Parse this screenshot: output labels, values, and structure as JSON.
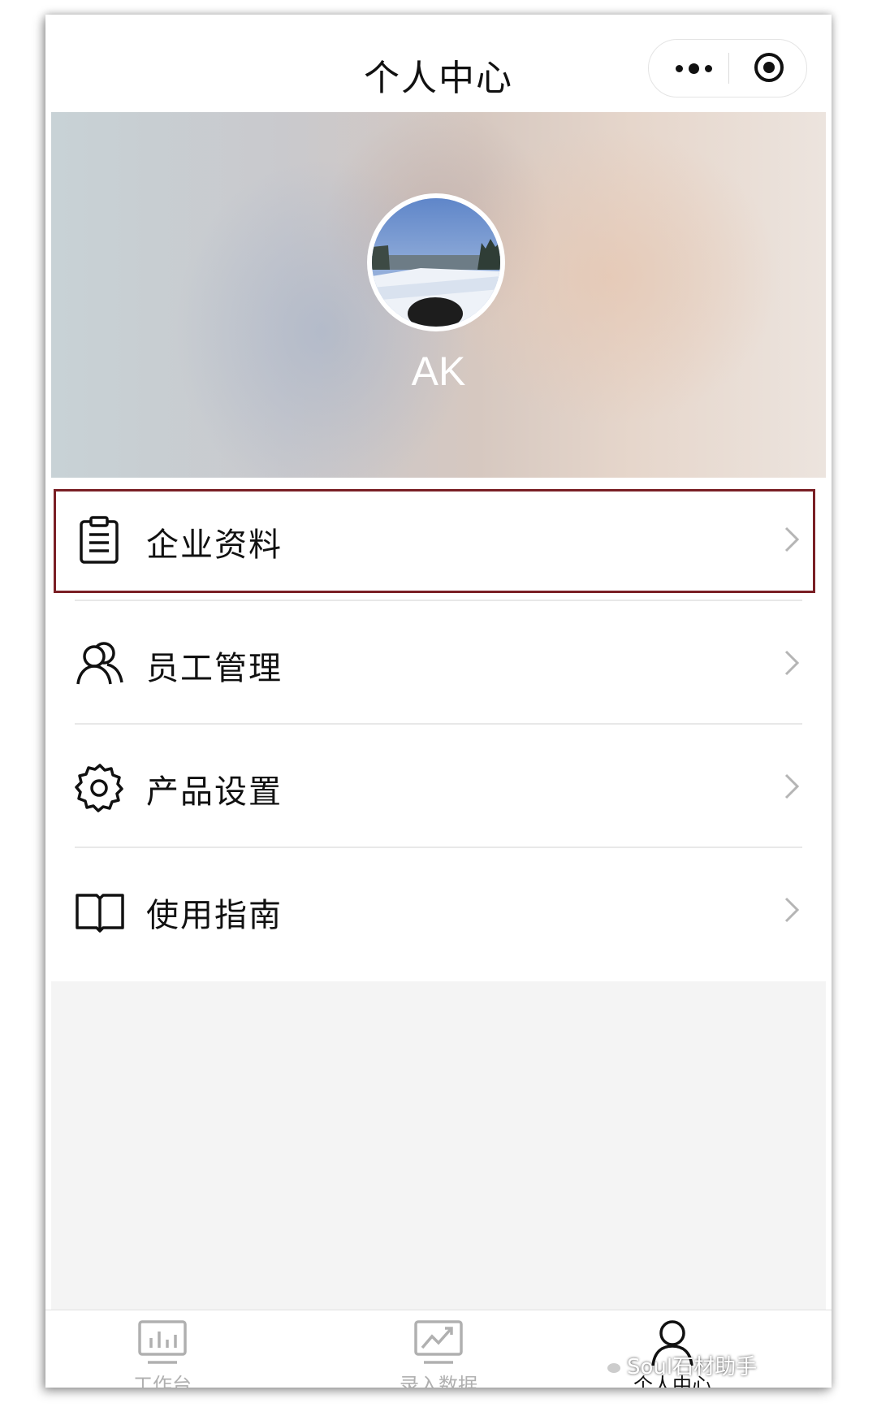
{
  "header": {
    "title": "个人中心"
  },
  "profile": {
    "name": "AK"
  },
  "menu": {
    "items": [
      {
        "label": "企业资料",
        "icon": "clipboard-icon"
      },
      {
        "label": "员工管理",
        "icon": "users-icon"
      },
      {
        "label": "产品设置",
        "icon": "gear-icon"
      },
      {
        "label": "使用指南",
        "icon": "book-icon"
      }
    ]
  },
  "tabbar": {
    "items": [
      {
        "label": "工作台",
        "icon": "bar-chart-icon"
      },
      {
        "label": "录入数据",
        "icon": "trend-chart-icon"
      },
      {
        "label": "个人中心",
        "icon": "user-icon"
      }
    ],
    "active_index": 2
  },
  "watermark": {
    "text": "Soul石材助手"
  },
  "colors": {
    "highlight_border": "#7a1f25",
    "inactive_tab": "#b0b0b0"
  }
}
